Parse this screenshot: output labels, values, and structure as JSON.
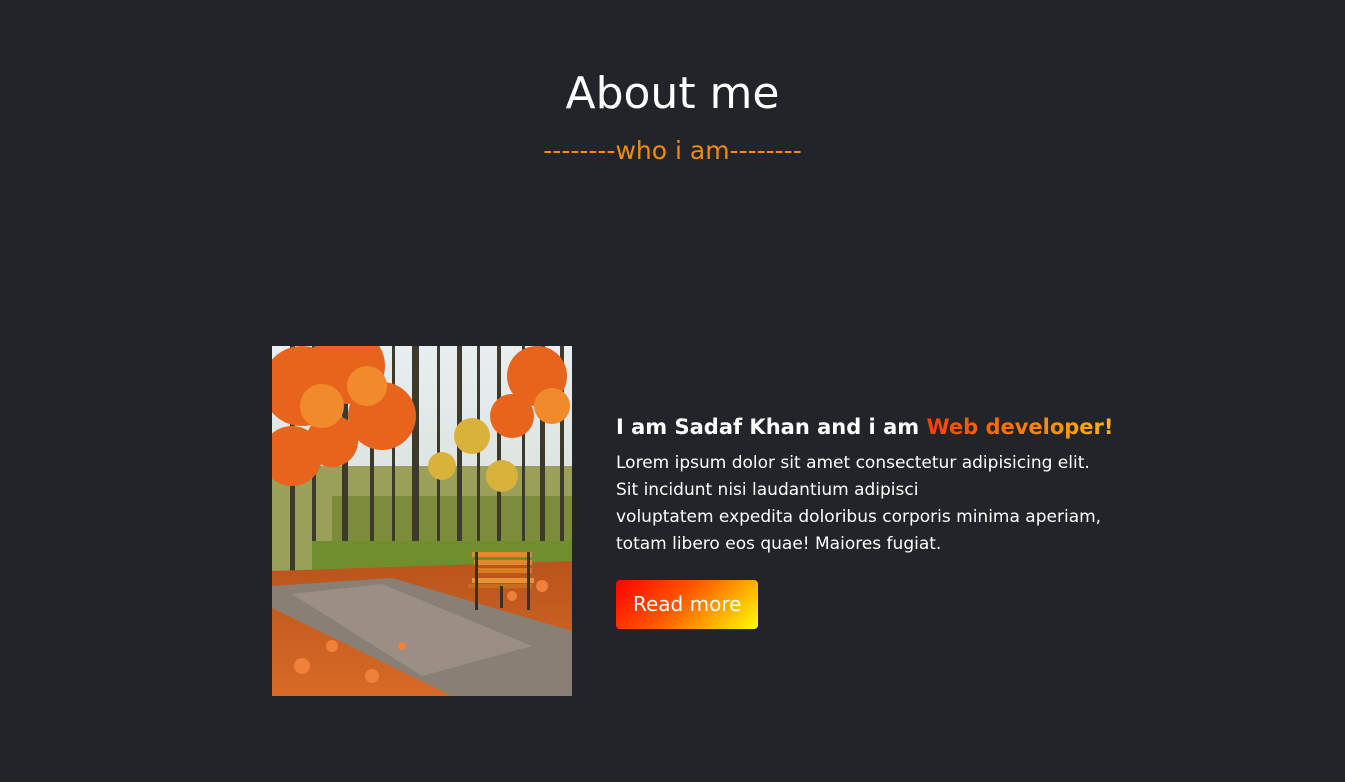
{
  "section": {
    "title": "About me",
    "subtitle": "--------who i am--------"
  },
  "about": {
    "intro_prefix": "I am Sadaf Khan and i am ",
    "intro_highlight": "Web developer!",
    "description_lines": [
      "Lorem ipsum dolor sit amet consectetur adipisicing elit.",
      "Sit incidunt nisi laudantium adipisci",
      "voluptatem expedita doloribus corporis minima aperiam,",
      "totam libero eos quae! Maiores fugiat."
    ],
    "button_label": "Read more"
  },
  "colors": {
    "background": "#212429",
    "accent": "#f58a07",
    "text": "#ffffff"
  }
}
